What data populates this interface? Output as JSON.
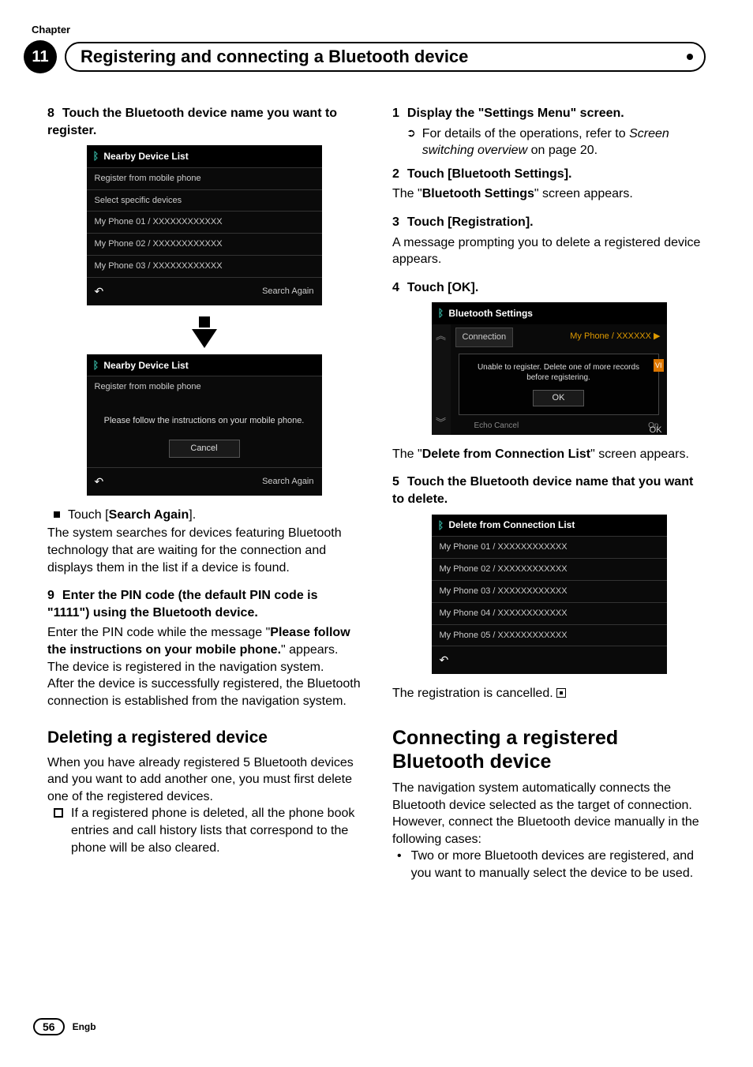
{
  "chapterLabel": "Chapter",
  "chapterNum": "11",
  "title": "Registering and connecting a Bluetooth device",
  "left": {
    "step8": {
      "num": "8",
      "txt": "Touch the Bluetooth device name you want to register."
    },
    "ssA": {
      "hdr": "Nearby Device List",
      "rows": [
        "Register from mobile phone",
        "Select specific devices",
        "My Phone 01 / XXXXXXXXXXXX",
        "My Phone 02 / XXXXXXXXXXXX",
        "My Phone 03 / XXXXXXXXXXXX"
      ],
      "again": "Search Again"
    },
    "ssB": {
      "hdr": "Nearby Device List",
      "row0": "Register from mobile phone",
      "msg": "Please follow the instructions on your mobile phone.",
      "cancel": "Cancel",
      "again": "Search Again"
    },
    "searchAgainBullet": {
      "pre": "Touch [",
      "bold": "Search Again",
      "post": "]."
    },
    "searchAgainBody": "The system searches for devices featuring Bluetooth technology that are waiting for the connection and displays them in the list if a device is found.",
    "step9": {
      "num": "9",
      "txt": "Enter the PIN code (the default PIN code is \"1111\") using the Bluetooth device."
    },
    "step9body1a": "Enter the PIN code while the message \"",
    "step9body1b": "Please follow the instructions on your mobile phone.",
    "step9body1c": "\" appears.",
    "step9body2": "The device is registered in the navigation system.",
    "step9body3": "After the device is successfully registered, the Bluetooth connection is established from the navigation system.",
    "h2": "Deleting a registered device",
    "delBody": "When you have already registered 5 Bluetooth devices and you want to add another one, you must first delete one of the registered devices.",
    "delNote": "If a registered phone is deleted, all the phone book entries and call history lists that correspond to the phone will be also cleared."
  },
  "right": {
    "step1": {
      "num": "1",
      "txt": "Display the \"Settings Menu\" screen."
    },
    "step1note": {
      "pre": "For details of the operations, refer to ",
      "ital": "Screen switching overview",
      "post": " on page 20."
    },
    "step2": {
      "num": "2",
      "txt": "Touch [Bluetooth Settings]."
    },
    "step2body": {
      "a": "The \"",
      "b": "Bluetooth Settings",
      "c": "\" screen appears."
    },
    "step3": {
      "num": "3",
      "txt": "Touch [Registration]."
    },
    "step3body": "A message prompting you to delete a registered device appears.",
    "step4": {
      "num": "4",
      "txt": "Touch [OK]."
    },
    "ssC": {
      "hdr": "Bluetooth Settings",
      "conn": "Connection",
      "phone": "My Phone / XXXXXX",
      "msg": "Unable to register.  Delete one of more records before registering.",
      "ok": "OK",
      "echo": "Echo Cancel",
      "on": "On",
      "okbtn": "OK",
      "badge": "VI"
    },
    "step4body": {
      "a": "The \"",
      "b": "Delete from Connection List",
      "c": "\" screen appears."
    },
    "step5": {
      "num": "5",
      "txt": "Touch the Bluetooth device name that you want to delete."
    },
    "ssD": {
      "hdr": "Delete from Connection List",
      "rows": [
        "My Phone 01 / XXXXXXXXXXXX",
        "My Phone 02 / XXXXXXXXXXXX",
        "My Phone 03 / XXXXXXXXXXXX",
        "My Phone 04 / XXXXXXXXXXXX",
        "My Phone 05 / XXXXXXXXXXXX"
      ]
    },
    "regCancelled": "The registration is cancelled.",
    "h1": "Connecting a registered Bluetooth device",
    "connBody": "The navigation system automatically connects the Bluetooth device selected as the target of connection. However, connect the Bluetooth device manually in the following cases:",
    "connBullet": "Two or more Bluetooth devices are registered, and you want to manually select the device to be used."
  },
  "pageNum": "56",
  "lang": "Engb"
}
